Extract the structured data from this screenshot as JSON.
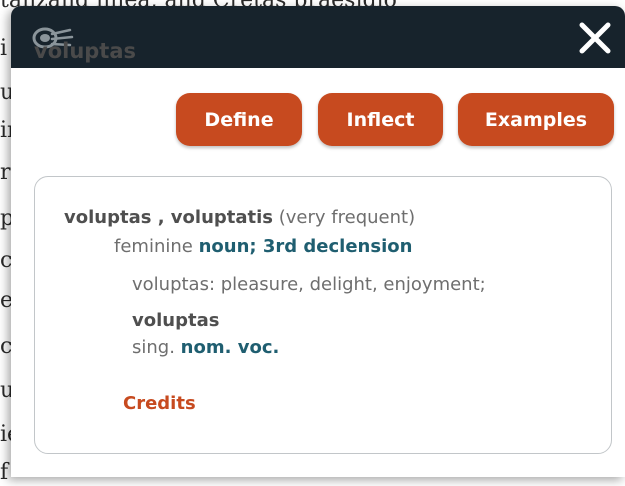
{
  "background": {
    "top_line": "tanzand linea, and Cretas praesidio",
    "fragments": [
      "i",
      "u",
      "ir",
      "r",
      "p",
      "c",
      "e",
      "c",
      "u",
      "ie",
      "f"
    ]
  },
  "popup": {
    "close_label": "✕",
    "query_word": "voluptas",
    "buttons": {
      "define": "Define",
      "inflect": "Inflect",
      "examples": "Examples"
    },
    "result": {
      "lemma": "voluptas , voluptatis",
      "frequency": "(very frequent)",
      "gender": "feminine",
      "pos": "noun; 3rd declension",
      "definition": "voluptas: pleasure, delight, enjoyment;",
      "form_word": "voluptas",
      "number": "sing.",
      "cases": "nom. voc.",
      "credits": "Credits"
    }
  },
  "colors": {
    "titlebar": "#17232c",
    "accent": "#c74a1f",
    "teal": "#1f5e70"
  }
}
